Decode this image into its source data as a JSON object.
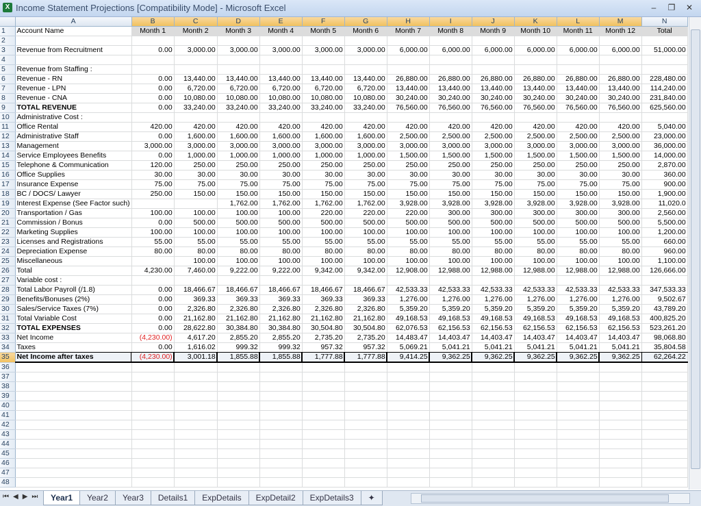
{
  "window": {
    "title": "Income Statement Projections  [Compatibility Mode] - Microsoft Excel",
    "app_icon": "X",
    "min": "–",
    "restore": "❐",
    "close": "✕"
  },
  "columns": [
    "A",
    "B",
    "C",
    "D",
    "E",
    "F",
    "G",
    "H",
    "I",
    "J",
    "K",
    "L",
    "M",
    "N"
  ],
  "rows": [
    {
      "n": "1",
      "cells": [
        "Account Name",
        "Month 1",
        "Month 2",
        "Month 3",
        "Month 4",
        "Month 5",
        "Month 6",
        "Month 7",
        "Month 8",
        "Month 9",
        "Month 10",
        "Month 11",
        "Month 12",
        "Total"
      ]
    },
    {
      "n": "2",
      "cells": [
        "",
        "",
        "",
        "",
        "",
        "",
        "",
        "",
        "",
        "",
        "",
        "",
        "",
        ""
      ]
    },
    {
      "n": "3",
      "cells": [
        "Revenue from Recruitment",
        "0.00",
        "3,000.00",
        "3,000.00",
        "3,000.00",
        "3,000.00",
        "3,000.00",
        "6,000.00",
        "6,000.00",
        "6,000.00",
        "6,000.00",
        "6,000.00",
        "6,000.00",
        "51,000.00"
      ]
    },
    {
      "n": "4",
      "cells": [
        "",
        "",
        "",
        "",
        "",
        "",
        "",
        "",
        "",
        "",
        "",
        "",
        "",
        ""
      ]
    },
    {
      "n": "5",
      "cells": [
        "Revenue from Staffing :",
        "",
        "",
        "",
        "",
        "",
        "",
        "",
        "",
        "",
        "",
        "",
        "",
        ""
      ]
    },
    {
      "n": "6",
      "cells": [
        "Revenue - RN",
        "0.00",
        "13,440.00",
        "13,440.00",
        "13,440.00",
        "13,440.00",
        "13,440.00",
        "26,880.00",
        "26,880.00",
        "26,880.00",
        "26,880.00",
        "26,880.00",
        "26,880.00",
        "228,480.00"
      ]
    },
    {
      "n": "7",
      "cells": [
        "Revenue - LPN",
        "0.00",
        "6,720.00",
        "6,720.00",
        "6,720.00",
        "6,720.00",
        "6,720.00",
        "13,440.00",
        "13,440.00",
        "13,440.00",
        "13,440.00",
        "13,440.00",
        "13,440.00",
        "114,240.00"
      ]
    },
    {
      "n": "8",
      "cells": [
        "Revenue - CNA",
        "0.00",
        "10,080.00",
        "10,080.00",
        "10,080.00",
        "10,080.00",
        "10,080.00",
        "30,240.00",
        "30,240.00",
        "30,240.00",
        "30,240.00",
        "30,240.00",
        "30,240.00",
        "231,840.00"
      ]
    },
    {
      "n": "9",
      "cells": [
        "TOTAL REVENUE",
        "0.00",
        "33,240.00",
        "33,240.00",
        "33,240.00",
        "33,240.00",
        "33,240.00",
        "76,560.00",
        "76,560.00",
        "76,560.00",
        "76,560.00",
        "76,560.00",
        "76,560.00",
        "625,560.00"
      ]
    },
    {
      "n": "10",
      "cells": [
        "Administrative Cost :",
        "",
        "",
        "",
        "",
        "",
        "",
        "",
        "",
        "",
        "",
        "",
        "",
        ""
      ]
    },
    {
      "n": "11",
      "cells": [
        "Office Rental",
        "420.00",
        "420.00",
        "420.00",
        "420.00",
        "420.00",
        "420.00",
        "420.00",
        "420.00",
        "420.00",
        "420.00",
        "420.00",
        "420.00",
        "5,040.00"
      ]
    },
    {
      "n": "12",
      "cells": [
        "Administrative Staff",
        "0.00",
        "1,600.00",
        "1,600.00",
        "1,600.00",
        "1,600.00",
        "1,600.00",
        "2,500.00",
        "2,500.00",
        "2,500.00",
        "2,500.00",
        "2,500.00",
        "2,500.00",
        "23,000.00"
      ]
    },
    {
      "n": "13",
      "cells": [
        "Management",
        "3,000.00",
        "3,000.00",
        "3,000.00",
        "3,000.00",
        "3,000.00",
        "3,000.00",
        "3,000.00",
        "3,000.00",
        "3,000.00",
        "3,000.00",
        "3,000.00",
        "3,000.00",
        "36,000.00"
      ]
    },
    {
      "n": "14",
      "cells": [
        "Service Employees Benefits",
        "0.00",
        "1,000.00",
        "1,000.00",
        "1,000.00",
        "1,000.00",
        "1,000.00",
        "1,500.00",
        "1,500.00",
        "1,500.00",
        "1,500.00",
        "1,500.00",
        "1,500.00",
        "14,000.00"
      ]
    },
    {
      "n": "15",
      "cells": [
        "Telephone & Communication",
        "120.00",
        "250.00",
        "250.00",
        "250.00",
        "250.00",
        "250.00",
        "250.00",
        "250.00",
        "250.00",
        "250.00",
        "250.00",
        "250.00",
        "2,870.00"
      ]
    },
    {
      "n": "16",
      "cells": [
        "Office Supplies",
        "30.00",
        "30.00",
        "30.00",
        "30.00",
        "30.00",
        "30.00",
        "30.00",
        "30.00",
        "30.00",
        "30.00",
        "30.00",
        "30.00",
        "360.00"
      ]
    },
    {
      "n": "17",
      "cells": [
        "Insurance Expense",
        "75.00",
        "75.00",
        "75.00",
        "75.00",
        "75.00",
        "75.00",
        "75.00",
        "75.00",
        "75.00",
        "75.00",
        "75.00",
        "75.00",
        "900.00"
      ]
    },
    {
      "n": "18",
      "cells": [
        "BC / DOCS/ Lawyer",
        "250.00",
        "150.00",
        "150.00",
        "150.00",
        "150.00",
        "150.00",
        "150.00",
        "150.00",
        "150.00",
        "150.00",
        "150.00",
        "150.00",
        "1,900.00"
      ]
    },
    {
      "n": "19",
      "cells": [
        "Interest Expense (See Factor such)",
        "",
        "",
        "1,762.00",
        "1,762.00",
        "1,762.00",
        "1,762.00",
        "3,928.00",
        "3,928.00",
        "3,928.00",
        "3,928.00",
        "3,928.00",
        "3,928.00",
        "11,020.0"
      ]
    },
    {
      "n": "20",
      "cells": [
        "Transportation / Gas",
        "100.00",
        "100.00",
        "100.00",
        "100.00",
        "220.00",
        "220.00",
        "220.00",
        "300.00",
        "300.00",
        "300.00",
        "300.00",
        "300.00",
        "2,560.00"
      ]
    },
    {
      "n": "21",
      "cells": [
        "Commission / Bonus",
        "0.00",
        "500.00",
        "500.00",
        "500.00",
        "500.00",
        "500.00",
        "500.00",
        "500.00",
        "500.00",
        "500.00",
        "500.00",
        "500.00",
        "5,500.00"
      ]
    },
    {
      "n": "22",
      "cells": [
        "Marketing Supplies",
        "100.00",
        "100.00",
        "100.00",
        "100.00",
        "100.00",
        "100.00",
        "100.00",
        "100.00",
        "100.00",
        "100.00",
        "100.00",
        "100.00",
        "1,200.00"
      ]
    },
    {
      "n": "23",
      "cells": [
        "Licenses and Registrations",
        "55.00",
        "55.00",
        "55.00",
        "55.00",
        "55.00",
        "55.00",
        "55.00",
        "55.00",
        "55.00",
        "55.00",
        "55.00",
        "55.00",
        "660.00"
      ]
    },
    {
      "n": "24",
      "cells": [
        "Depreciation Expense",
        "80.00",
        "80.00",
        "80.00",
        "80.00",
        "80.00",
        "80.00",
        "80.00",
        "80.00",
        "80.00",
        "80.00",
        "80.00",
        "80.00",
        "960.00"
      ]
    },
    {
      "n": "25",
      "cells": [
        "Miscellaneous",
        "",
        "100.00",
        "100.00",
        "100.00",
        "100.00",
        "100.00",
        "100.00",
        "100.00",
        "100.00",
        "100.00",
        "100.00",
        "100.00",
        "1,100.00"
      ]
    },
    {
      "n": "26",
      "cells": [
        "Total",
        "4,230.00",
        "7,460.00",
        "9,222.00",
        "9,222.00",
        "9,342.00",
        "9,342.00",
        "12,908.00",
        "12,988.00",
        "12,988.00",
        "12,988.00",
        "12,988.00",
        "12,988.00",
        "126,666.00"
      ]
    },
    {
      "n": "27",
      "cells": [
        "Variable cost :",
        "",
        "",
        "",
        "",
        "",
        "",
        "",
        "",
        "",
        "",
        "",
        "",
        ""
      ]
    },
    {
      "n": "28",
      "cells": [
        "Total Labor Payroll (/1.8)",
        "0.00",
        "18,466.67",
        "18,466.67",
        "18,466.67",
        "18,466.67",
        "18,466.67",
        "42,533.33",
        "42,533.33",
        "42,533.33",
        "42,533.33",
        "42,533.33",
        "42,533.33",
        "347,533.33"
      ]
    },
    {
      "n": "29",
      "cells": [
        "Benefits/Bonuses (2%)",
        "0.00",
        "369.33",
        "369.33",
        "369.33",
        "369.33",
        "369.33",
        "1,276.00",
        "1,276.00",
        "1,276.00",
        "1,276.00",
        "1,276.00",
        "1,276.00",
        "9,502.67"
      ]
    },
    {
      "n": "30",
      "cells": [
        "Sales/Service Taxes  (7%)",
        "0.00",
        "2,326.80",
        "2,326.80",
        "2,326.80",
        "2,326.80",
        "2,326.80",
        "5,359.20",
        "5,359.20",
        "5,359.20",
        "5,359.20",
        "5,359.20",
        "5,359.20",
        "43,789.20"
      ]
    },
    {
      "n": "31",
      "cells": [
        "Total Variable Cost",
        "0.00",
        "21,162.80",
        "21,162.80",
        "21,162.80",
        "21,162.80",
        "21,162.80",
        "49,168.53",
        "49,168.53",
        "49,168.53",
        "49,168.53",
        "49,168.53",
        "49,168.53",
        "400,825.20"
      ]
    },
    {
      "n": "32",
      "cells": [
        "TOTAL EXPENSES",
        "0.00",
        "28,622.80",
        "30,384.80",
        "30,384.80",
        "30,504.80",
        "30,504.80",
        "62,076.53",
        "62,156.53",
        "62,156.53",
        "62,156.53",
        "62,156.53",
        "62,156.53",
        "523,261.20"
      ]
    },
    {
      "n": "33",
      "cells": [
        "Net Income",
        "(4,230.00)",
        "4,617.20",
        "2,855.20",
        "2,855.20",
        "2,735.20",
        "2,735.20",
        "14,483.47",
        "14,403.47",
        "14,403.47",
        "14,403.47",
        "14,403.47",
        "14,403.47",
        "98,068.80"
      ]
    },
    {
      "n": "34",
      "cells": [
        "Taxes",
        "0.00",
        "1,616.02",
        "999.32",
        "999.32",
        "957.32",
        "957.32",
        "5,069.21",
        "5,041.21",
        "5,041.21",
        "5,041.21",
        "5,041.21",
        "5,041.21",
        "35,804.58"
      ]
    },
    {
      "n": "35",
      "cells": [
        "Net Income after taxes",
        "(4,230.00)",
        "3,001.18",
        "1,855.88",
        "1,855.88",
        "1,777.88",
        "1,777.88",
        "9,414.25",
        "9,362.25",
        "9,362.25",
        "9,362.25",
        "9,362.25",
        "9,362.25",
        "62,264.22"
      ]
    },
    {
      "n": "36",
      "cells": [
        "",
        "",
        "",
        "",
        "",
        "",
        "",
        "",
        "",
        "",
        "",
        "",
        "",
        ""
      ]
    },
    {
      "n": "37",
      "cells": [
        "",
        "",
        "",
        "",
        "",
        "",
        "",
        "",
        "",
        "",
        "",
        "",
        "",
        ""
      ]
    },
    {
      "n": "38",
      "cells": [
        "",
        "",
        "",
        "",
        "",
        "",
        "",
        "",
        "",
        "",
        "",
        "",
        "",
        ""
      ]
    },
    {
      "n": "39",
      "cells": [
        "",
        "",
        "",
        "",
        "",
        "",
        "",
        "",
        "",
        "",
        "",
        "",
        "",
        ""
      ]
    },
    {
      "n": "40",
      "cells": [
        "",
        "",
        "",
        "",
        "",
        "",
        "",
        "",
        "",
        "",
        "",
        "",
        "",
        ""
      ]
    },
    {
      "n": "41",
      "cells": [
        "",
        "",
        "",
        "",
        "",
        "",
        "",
        "",
        "",
        "",
        "",
        "",
        "",
        ""
      ]
    },
    {
      "n": "42",
      "cells": [
        "",
        "",
        "",
        "",
        "",
        "",
        "",
        "",
        "",
        "",
        "",
        "",
        "",
        ""
      ]
    },
    {
      "n": "43",
      "cells": [
        "",
        "",
        "",
        "",
        "",
        "",
        "",
        "",
        "",
        "",
        "",
        "",
        "",
        ""
      ]
    },
    {
      "n": "44",
      "cells": [
        "",
        "",
        "",
        "",
        "",
        "",
        "",
        "",
        "",
        "",
        "",
        "",
        "",
        ""
      ]
    },
    {
      "n": "45",
      "cells": [
        "",
        "",
        "",
        "",
        "",
        "",
        "",
        "",
        "",
        "",
        "",
        "",
        "",
        ""
      ]
    },
    {
      "n": "46",
      "cells": [
        "",
        "",
        "",
        "",
        "",
        "",
        "",
        "",
        "",
        "",
        "",
        "",
        "",
        ""
      ]
    },
    {
      "n": "47",
      "cells": [
        "",
        "",
        "",
        "",
        "",
        "",
        "",
        "",
        "",
        "",
        "",
        "",
        "",
        ""
      ]
    },
    {
      "n": "48",
      "cells": [
        "",
        "",
        "",
        "",
        "",
        "",
        "",
        "",
        "",
        "",
        "",
        "",
        "",
        ""
      ]
    }
  ],
  "sheet_tabs": [
    "Year1",
    "Year2",
    "Year3",
    "Details1",
    "ExpDetails",
    "ExpDetail2",
    "ExpDetails3"
  ],
  "active_tab": "Year1",
  "nav": [
    "⏮",
    "◀",
    "▶",
    "⏭"
  ],
  "colors": {
    "negative": "#e02020",
    "selection_header": "#f1c15f"
  }
}
